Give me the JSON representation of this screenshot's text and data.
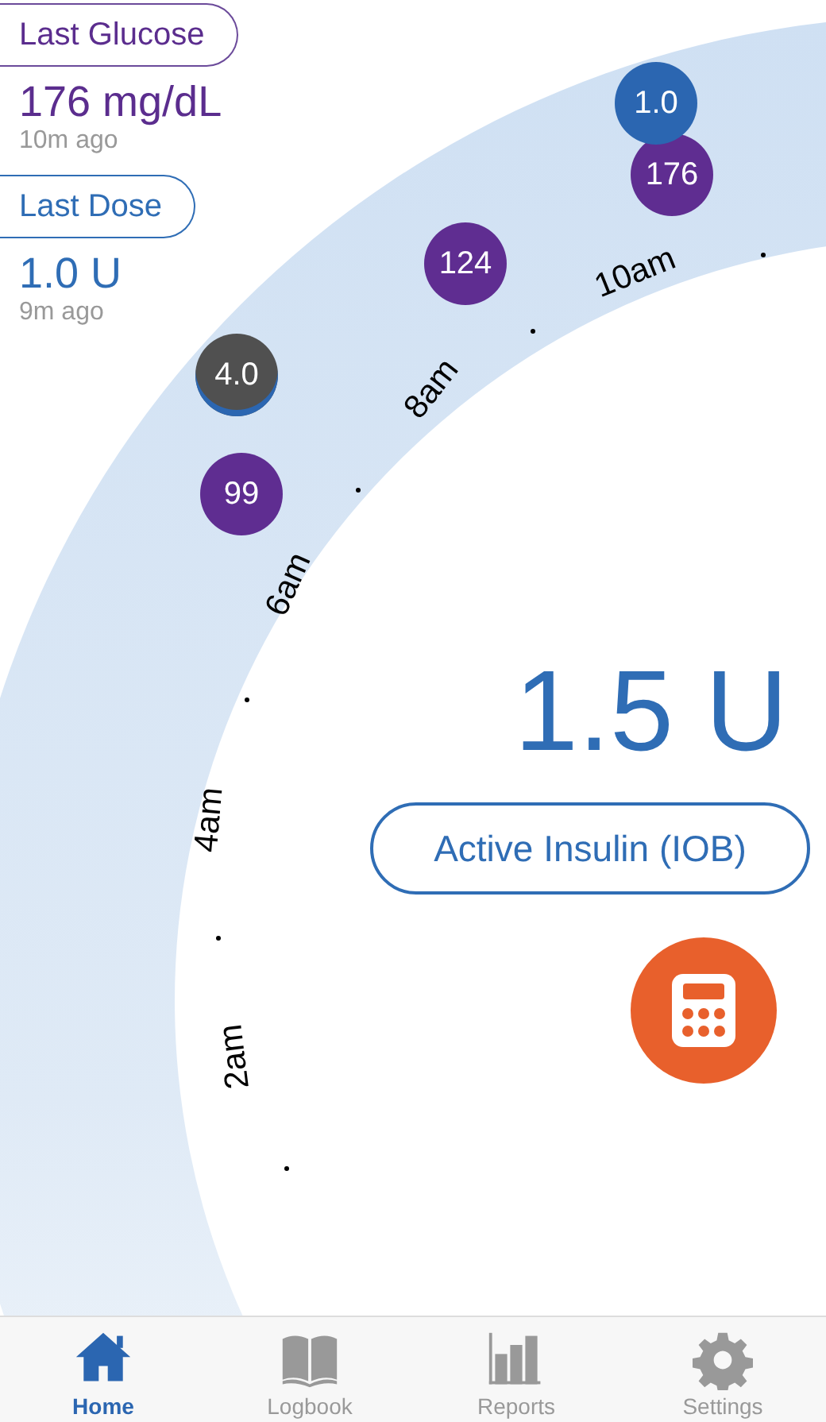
{
  "last_glucose": {
    "label": "Last Glucose",
    "value": "176 mg/dL",
    "age": "10m ago"
  },
  "last_dose": {
    "label": "Last Dose",
    "value": "1.0 U",
    "age": "9m ago"
  },
  "timeline": {
    "time_labels": [
      "10am",
      "8am",
      "6am",
      "4am",
      "2am"
    ],
    "markers": [
      {
        "kind": "dose",
        "text": "1.0",
        "color": "#2b66b1"
      },
      {
        "kind": "glucose",
        "text": "176",
        "color": "#5f2d91"
      },
      {
        "kind": "glucose",
        "text": "124",
        "color": "#5f2d91"
      },
      {
        "kind": "dose",
        "text": "4.0",
        "color": "#505050"
      },
      {
        "kind": "glucose",
        "text": "99",
        "color": "#5f2d91"
      }
    ]
  },
  "active_insulin": {
    "value": "1.5 U",
    "label": "Active Insulin (IOB)"
  },
  "tab_bar": [
    {
      "label": "Home",
      "kind": "home",
      "selected": true
    },
    {
      "label": "Logbook",
      "kind": "book",
      "selected": false
    },
    {
      "label": "Reports",
      "kind": "chart",
      "selected": false
    },
    {
      "label": "Settings",
      "kind": "gear",
      "selected": false
    }
  ]
}
